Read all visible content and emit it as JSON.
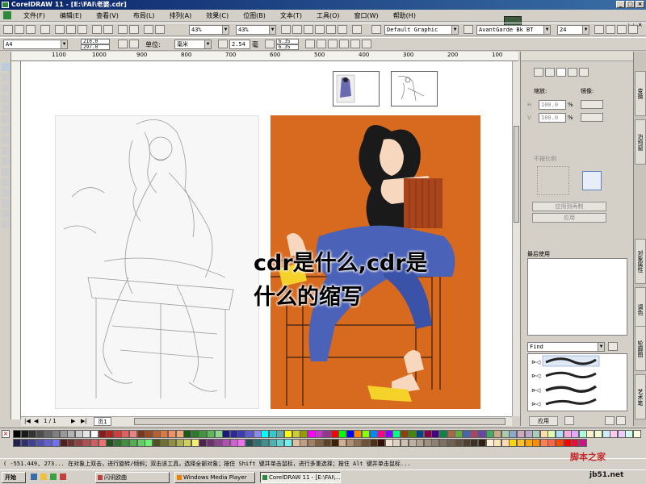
{
  "window": {
    "title": "CorelDRAW 11 - [E:\\FAI\\老婆.cdr]",
    "min": "_",
    "max": "□",
    "close": "×"
  },
  "menu": {
    "items": [
      "文件(F)",
      "编辑(E)",
      "查看(V)",
      "布局(L)",
      "排列(A)",
      "效果(C)",
      "位图(B)",
      "文本(T)",
      "工具(O)",
      "窗口(W)",
      "帮助(H)"
    ]
  },
  "toolbar1": {
    "zoom1": "43%",
    "zoom2": "43%",
    "font_style": "Default Graphic",
    "font_name": "AvantGarde Bk BT",
    "font_size": "24"
  },
  "toolbar2": {
    "paper": "A4",
    "width": "210.0",
    "height": "297.0",
    "unit_label": "单位:",
    "unit": "毫米",
    "nudge": "2.54",
    "nudge_unit": "毫",
    "dup_x": "6.35",
    "dup_y": "6.35"
  },
  "ruler": {
    "labels": [
      "1100",
      "1000",
      "900",
      "800",
      "700",
      "600",
      "500",
      "400",
      "300",
      "200",
      "100"
    ]
  },
  "pager": {
    "count": "1 / 1",
    "page_tab": "页1"
  },
  "dock": {
    "scale_label": "缩放:",
    "mirror_label": "镜像:",
    "scale_x": "100.0",
    "scale_y": "100.0",
    "pct": "%",
    "proportional": "不按比例",
    "apply_dup": "应用到再制",
    "apply": "应用",
    "recent_header": "最后使用",
    "find_value": "Find",
    "bottom_apply": "应用"
  },
  "sidetabs": [
    "变换",
    "泊坞窗",
    "对象属性",
    "调色",
    "轮廓图",
    "艺术笔"
  ],
  "palette": {
    "row1": [
      "#000000",
      "#1a1a1a",
      "#333333",
      "#4d4d4d",
      "#666666",
      "#808080",
      "#999999",
      "#b3b3b3",
      "#cccccc",
      "#e6e6e6",
      "#ffffff",
      "#8b1a1a",
      "#b22222",
      "#d23c3c",
      "#e06060",
      "#f08080",
      "#7a3a1a",
      "#9a4a20",
      "#ba6030",
      "#da7a40",
      "#f09060",
      "#f0a878",
      "#1a5a1a",
      "#2a7a2a",
      "#3a9a3a",
      "#5aba5a",
      "#8ada8a",
      "#1a1a7a",
      "#2a2a9a",
      "#3a3aba",
      "#5a5ada",
      "#8a8aea",
      "#00ffff",
      "#33cccc",
      "#66aaaa",
      "#ffff00",
      "#cccc33",
      "#999900",
      "#ff00ff",
      "#cc33cc",
      "#993399",
      "#ff0000",
      "#00ff00",
      "#0000ff",
      "#ff8800",
      "#88ff00",
      "#0088ff",
      "#ff0088",
      "#8800ff",
      "#00ff88",
      "#884400",
      "#448800",
      "#004488",
      "#880044",
      "#440088",
      "#008844",
      "#aa6644",
      "#66aa44",
      "#4466aa",
      "#aa4466",
      "#6644aa",
      "#44aa66",
      "#ccaa88",
      "#aaccaa",
      "#88aacc",
      "#ccaabb",
      "#bbaacc",
      "#aaccbb",
      "#ffddaa",
      "#ddffaa",
      "#aaddff",
      "#ffaadd",
      "#ddaaff",
      "#aaffdd",
      "#ffeecc",
      "#eeffcc",
      "#cceeff",
      "#ffccee",
      "#eeccff",
      "#ccffee",
      "#ffffdd"
    ],
    "row2": [
      "#202050",
      "#303070",
      "#404090",
      "#5050b0",
      "#6060d0",
      "#7070f0",
      "#502020",
      "#703030",
      "#904040",
      "#b05050",
      "#d06060",
      "#f07070",
      "#205020",
      "#307030",
      "#409040",
      "#50b050",
      "#60d060",
      "#70f070",
      "#505020",
      "#707030",
      "#909040",
      "#b0b050",
      "#d0d060",
      "#f0f070",
      "#502050",
      "#703070",
      "#904090",
      "#b050b0",
      "#d060d0",
      "#f070f0",
      "#205050",
      "#307070",
      "#409090",
      "#50b0b0",
      "#60d0d0",
      "#70f0f0",
      "#e0c0a0",
      "#c0a080",
      "#a08060",
      "#806040",
      "#604020",
      "#402000",
      "#d0b090",
      "#b09070",
      "#907050",
      "#705030",
      "#503010",
      "#301000",
      "#f0e0d0",
      "#e0d0c0",
      "#d0c0b0",
      "#c0b0a0",
      "#b0a090",
      "#a09080",
      "#908070",
      "#807060",
      "#706050",
      "#605040",
      "#504030",
      "#403020",
      "#302010",
      "#ffefd5",
      "#ffe4b5",
      "#ffdab9",
      "#ffd700",
      "#ffc125",
      "#ffa500",
      "#ff8c00",
      "#ff7f50",
      "#ff6347",
      "#ff4500",
      "#ff0000",
      "#dc143c",
      "#c71585"
    ]
  },
  "status": {
    "text": "( -551.449, 273... 在对象上双击，进行旋转/倾斜；双击该工具，选择全部对象；按住 Shift 键并单击鼠标，进行多重选择；按住 Alt 键并单击鼠标..."
  },
  "taskbar": {
    "start": "开始",
    "tasks": [
      "闪讯欧曲",
      "Windows Media Player",
      "CorelDRAW 11 - [E:\\FAI\\..."
    ]
  },
  "overlay": {
    "title": "cdr是什么,cdr是什么的缩写"
  },
  "watermark": {
    "line1": "脚本之家",
    "line2": "jb51.net"
  },
  "colors": {
    "page_orange": "#d76a1f",
    "title_blue": "#0a246a"
  }
}
